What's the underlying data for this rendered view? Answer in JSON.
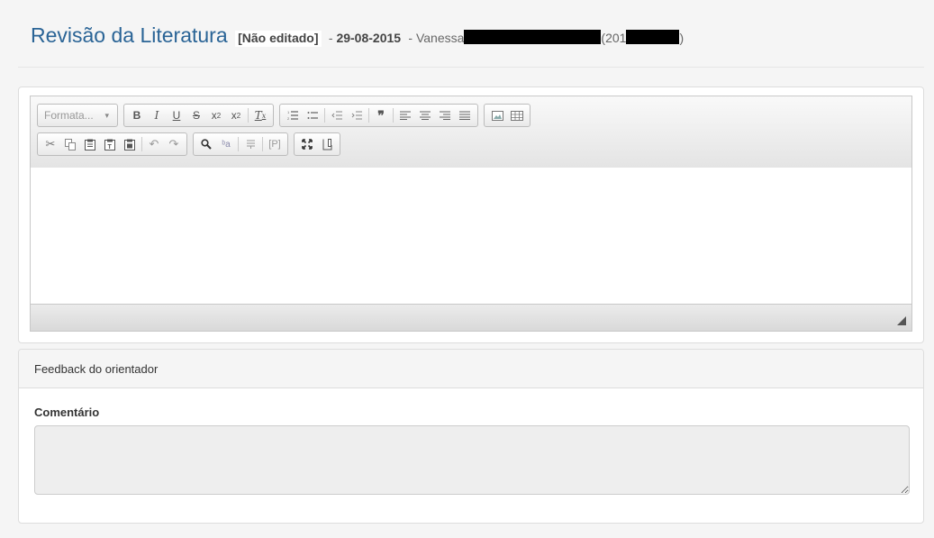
{
  "header": {
    "title": "Revisão da Literatura",
    "tag": "[Não editado]",
    "date": "29-08-2015",
    "separator": "-",
    "author": "Vanessa",
    "paren_open": "(201",
    "paren_close": ")"
  },
  "editor": {
    "format_label": "Formata...",
    "toolbar_row1": [
      "bold-icon",
      "italic-icon",
      "underline-icon",
      "strikethrough-icon",
      "subscript-icon",
      "superscript-icon",
      "remove-format-icon",
      "numbered-list-icon",
      "bulleted-list-icon",
      "decrease-indent-icon",
      "increase-indent-icon",
      "blockquote-icon",
      "align-left-icon",
      "align-center-icon",
      "align-right-icon",
      "justify-icon",
      "image-icon",
      "table-icon"
    ],
    "toolbar_row2": [
      "cut-icon",
      "copy-icon",
      "paste-icon",
      "paste-text-icon",
      "paste-word-icon",
      "undo-icon",
      "redo-icon",
      "find-icon",
      "replace-icon",
      "show-blocks-icon",
      "paragraph-icon",
      "maximize-icon",
      "source-icon"
    ]
  },
  "feedback": {
    "heading": "Feedback do orientador",
    "label": "Comentário",
    "value": ""
  }
}
